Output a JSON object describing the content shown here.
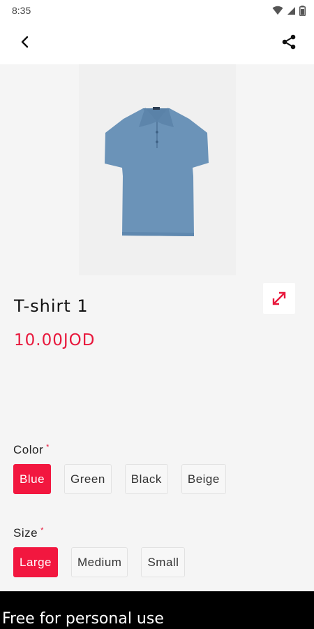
{
  "status_bar": {
    "time": "8:35",
    "icons": [
      "wifi-icon",
      "signal-icon",
      "battery-icon"
    ]
  },
  "app_bar": {
    "back_icon": "chevron-left-icon",
    "share_icon": "share-icon"
  },
  "product": {
    "image_description_icon": "polo-shirt-image",
    "title": "T-shirt 1",
    "price": "10.00JOD",
    "expand_icon": "expand-diagonal-icon"
  },
  "options": {
    "color": {
      "label": "Color",
      "required_mark": "*",
      "choices": [
        "Blue",
        "Green",
        "Black",
        "Beige"
      ],
      "selected": "Blue"
    },
    "size": {
      "label": "Size",
      "required_mark": "*",
      "choices": [
        "Large",
        "Medium",
        "Small"
      ],
      "selected": "Large"
    }
  },
  "footer": {
    "text": "Free for personal use"
  },
  "colors": {
    "accent": "#f2173f",
    "price": "#e8183c",
    "shirt": "#6b93b8"
  }
}
